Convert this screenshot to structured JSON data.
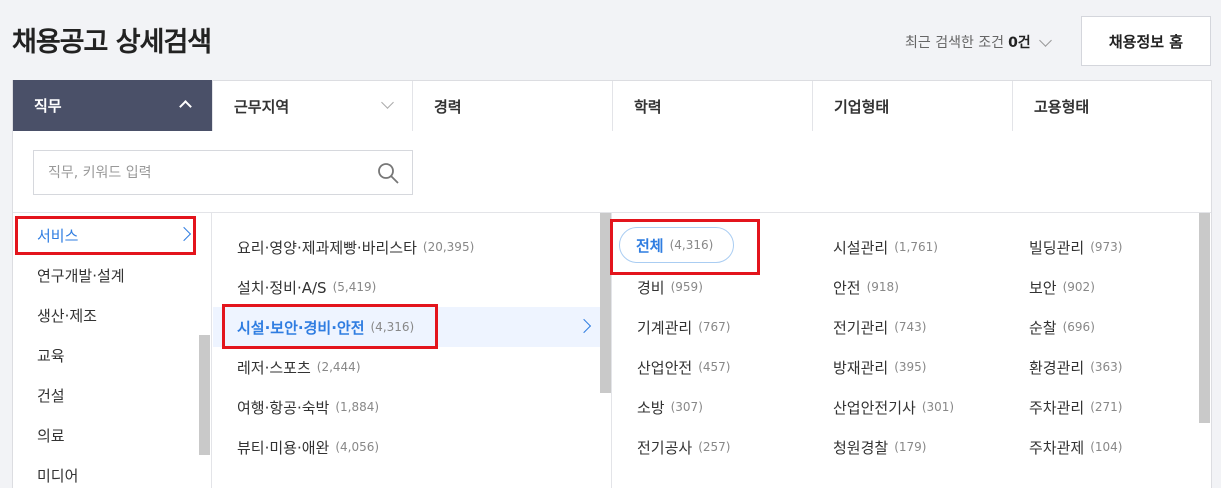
{
  "header": {
    "title": "채용공고 상세검색",
    "recent_prefix": "최근 검색한 조건",
    "recent_count": "0건",
    "home_button": "채용정보 홈"
  },
  "tabs": [
    {
      "label": "직무"
    },
    {
      "label": "근무지역"
    },
    {
      "label": "경력"
    },
    {
      "label": "학력"
    },
    {
      "label": "기업형태"
    },
    {
      "label": "고용형태"
    }
  ],
  "search": {
    "placeholder": "직무, 키워드 입력"
  },
  "categories": [
    {
      "label": "서비스"
    },
    {
      "label": "연구개발·설계"
    },
    {
      "label": "생산·제조"
    },
    {
      "label": "교육"
    },
    {
      "label": "건설"
    },
    {
      "label": "의료"
    },
    {
      "label": "미디어"
    }
  ],
  "subcategories": [
    {
      "label": "요리·영양·제과제빵·바리스타",
      "count": "(20,395)"
    },
    {
      "label": "설치·정비·A/S",
      "count": "(5,419)"
    },
    {
      "label": "시설·보안·경비·안전",
      "count": "(4,316)"
    },
    {
      "label": "레저·스포츠",
      "count": "(2,444)"
    },
    {
      "label": "여행·항공·숙박",
      "count": "(1,884)"
    },
    {
      "label": "뷰티·미용·애완",
      "count": "(4,056)"
    }
  ],
  "jobs": {
    "all": {
      "label": "전체",
      "count": "(4,316)"
    },
    "col_a": [
      {
        "label": "경비",
        "count": "(959)"
      },
      {
        "label": "기계관리",
        "count": "(767)"
      },
      {
        "label": "산업안전",
        "count": "(457)"
      },
      {
        "label": "소방",
        "count": "(307)"
      },
      {
        "label": "전기공사",
        "count": "(257)"
      }
    ],
    "col_b": [
      {
        "label": "시설관리",
        "count": "(1,761)"
      },
      {
        "label": "안전",
        "count": "(918)"
      },
      {
        "label": "전기관리",
        "count": "(743)"
      },
      {
        "label": "방재관리",
        "count": "(395)"
      },
      {
        "label": "산업안전기사",
        "count": "(301)"
      },
      {
        "label": "청원경찰",
        "count": "(179)"
      }
    ],
    "col_c": [
      {
        "label": "빌딩관리",
        "count": "(973)"
      },
      {
        "label": "보안",
        "count": "(902)"
      },
      {
        "label": "순찰",
        "count": "(696)"
      },
      {
        "label": "환경관리",
        "count": "(363)"
      },
      {
        "label": "주차관리",
        "count": "(271)"
      },
      {
        "label": "주차관제",
        "count": "(104)"
      }
    ]
  },
  "colors": {
    "accent": "#2f7de1",
    "tab_active": "#4a5068",
    "highlight": "#e3141c"
  }
}
